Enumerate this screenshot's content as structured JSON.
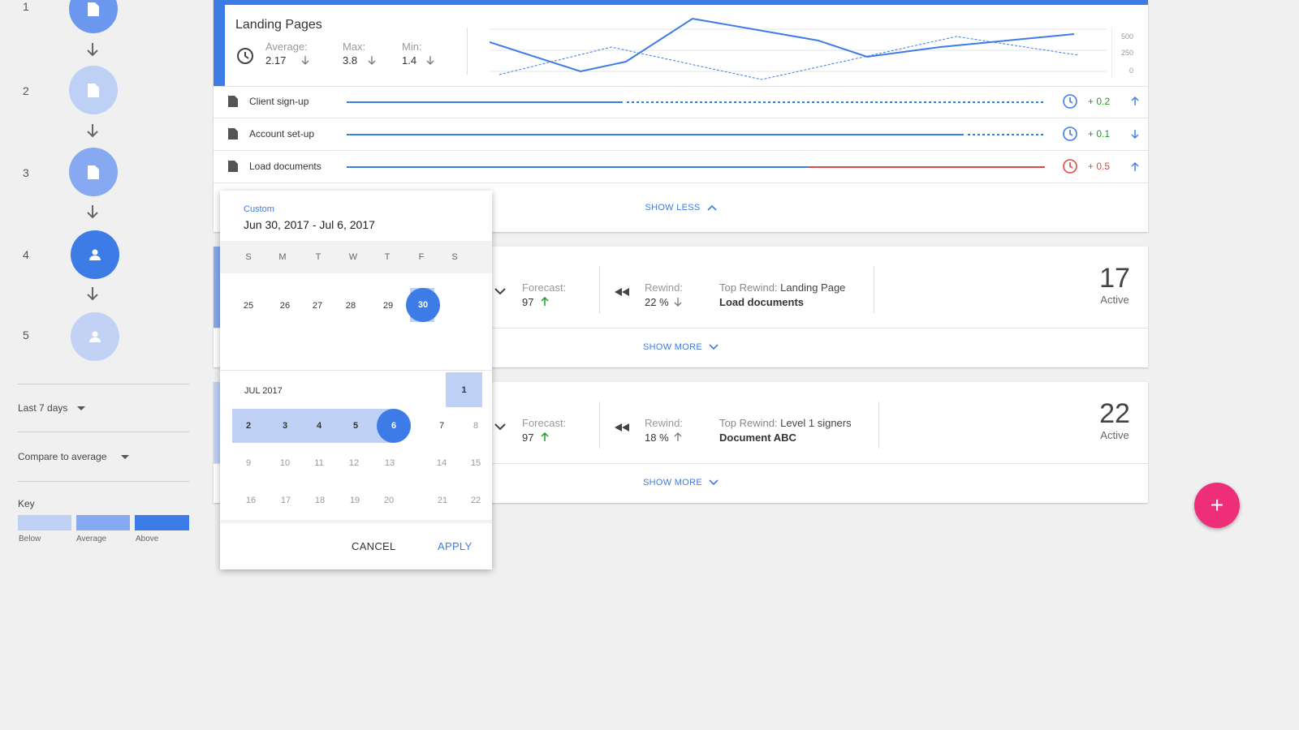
{
  "steps": [
    {
      "num": "1",
      "color": "#6b97ef",
      "icon": "document-icon"
    },
    {
      "num": "2",
      "color": "#bed0f4",
      "icon": "document-icon"
    },
    {
      "num": "3",
      "color": "#87a9f1",
      "icon": "document-icon"
    },
    {
      "num": "4",
      "color": "#3d7be6",
      "icon": "person-icon"
    },
    {
      "num": "5",
      "color": "#c1d2f5",
      "icon": "person-icon"
    }
  ],
  "filters": {
    "range": "Last 7 days",
    "compare": "Compare to average"
  },
  "key": {
    "title": "Key",
    "below": "Below",
    "average": "Average",
    "above": "Above",
    "colors": {
      "below": "#bed0f4",
      "average": "#87a9f1",
      "above": "#3d7be6"
    }
  },
  "landing": {
    "title": "Landing Pages",
    "average_label": "Average:",
    "average_value": "2.17",
    "max_label": "Max:",
    "max_value": "3.8",
    "min_label": "Min:",
    "min_value": "1.4",
    "chart_ticks": [
      "500",
      "250",
      "0"
    ],
    "rows": [
      {
        "label": "Client sign-up",
        "delta": "+ 0.2",
        "delta_color": "#1a9e2c",
        "clock_color": "#3d7be6",
        "dir": "up",
        "solid": 0.4,
        "dash_color": "#3d7be6"
      },
      {
        "label": "Account set-up",
        "delta": "+ 0.1",
        "delta_color": "#1a9e2c",
        "clock_color": "#3d7be6",
        "dir": "down",
        "solid": 0.89,
        "dash_color": "#3d7be6"
      },
      {
        "label": "Load documents",
        "delta": "+ 0.5",
        "delta_color": "#e04848",
        "clock_color": "#e04848",
        "dir": "up",
        "solid": 0.66,
        "dash_color": "#e04848"
      }
    ],
    "show_less": "SHOW LESS"
  },
  "card2": {
    "forecast_label": "Forecast:",
    "forecast_value": "97",
    "rewind_label": "Rewind:",
    "rewind_value": "22 %",
    "top_rewind_label": "Top Rewind:",
    "top_rewind_value": "Landing Page",
    "doc": "Load documents",
    "count": "17",
    "count_label": "Active",
    "show_more": "SHOW MORE"
  },
  "card3": {
    "forecast_label": "Forecast:",
    "forecast_value": "97",
    "rewind_label": "Rewind:",
    "rewind_value": "18 %",
    "top_rewind_label": "Top Rewind:",
    "top_rewind_value": "Level 1 signers",
    "doc": "Document ABC",
    "count": "22",
    "count_label": "Active",
    "show_more": "SHOW MORE"
  },
  "calendar": {
    "mode": "Custom",
    "range": "Jun 30, 2017 - Jul 6, 2017",
    "dow": [
      "S",
      "M",
      "T",
      "W",
      "T",
      "F",
      "S"
    ],
    "june_row": [
      "25",
      "26",
      "27",
      "28",
      "29",
      "30"
    ],
    "month_label": "JUL 2017",
    "jul_row1": [
      "1"
    ],
    "jul_row2": [
      "2",
      "3",
      "4",
      "5",
      "6",
      "7",
      "8"
    ],
    "jul_row3": [
      "9",
      "10",
      "11",
      "12",
      "13",
      "14",
      "15"
    ],
    "jul_row4": [
      "16",
      "17",
      "18",
      "19",
      "20",
      "21",
      "22"
    ],
    "cancel": "CANCEL",
    "apply": "APPLY"
  },
  "fab": {
    "label": "+"
  }
}
